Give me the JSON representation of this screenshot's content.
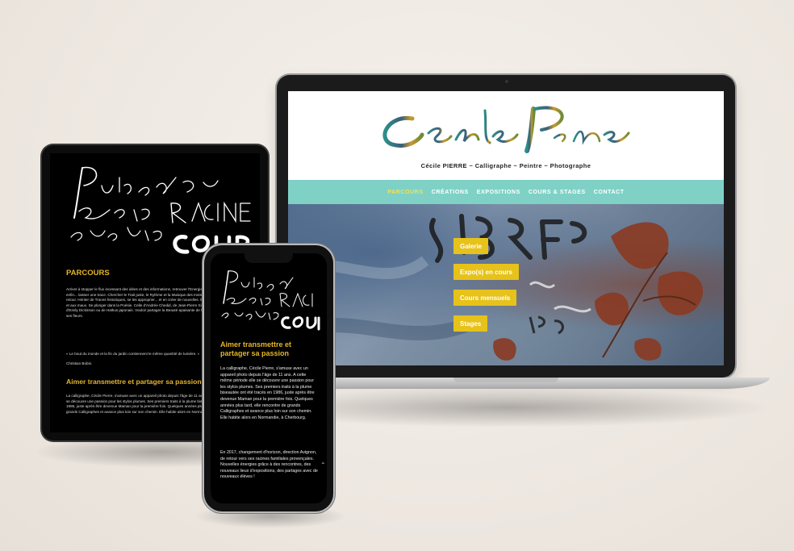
{
  "laptop": {
    "tagline": "Cécile PIERRE ~ Calligraphe ~ Peintre ~ Photographe",
    "nav": [
      "PARCOURS",
      "CRÉATIONS",
      "EXPOSITIONS",
      "COURS & STAGES",
      "CONTACT"
    ],
    "hero_buttons": [
      "Galerie",
      "Expo(s) en cours",
      "Cours mensuels",
      "Stages"
    ]
  },
  "tablet": {
    "section1_heading": "PARCOURS",
    "para1": "Arriver à stopper le flux incessant des idées et des informations, retrouver l'Energie, la libérer grâce au Souffle et enfin... laisser une trace. Chercher le Trait juste, le Rythme et la Musique des mots, le Silence qui les révèlent en retour. Hériter de Traces historiques, se les approprier... et en créer de nouvelles. Être sensible (trop ?) aux Mots et aux maux. Se plonger dans la Poésie. Celle d'Andrée Chedid, de Jean-Pierre Siméon, François Cheng, d'Emily Dickinson ou de Haïkus japonais. Vouloir partager la Beauté apaisante de la Nature qui nous entoure, de ses fleurs.",
    "quote": "« Le bout du monde et la fin du jardin contiennent le même quantité de lumière. »",
    "author": "Christian Bobin.",
    "section2_heading": "Aimer transmettre et partager sa passion",
    "para2": "La calligraphe, Cécile Pierre, s'amuse avec un appareil photo depuis l'âge de 11 ans. A cette même période elle se découvre une passion pour les stylos plumes. Ses premiers traits à la plume biseautée ont été tracés en 1986, juste après être devenue Maman pour la première fois. Quelques années plus tard, elle rencontre de grands Calligraphes et avance plus loin sur son chemin. Elle habite alors en Normandie, à Cherbourg."
  },
  "phone": {
    "heading": "Aimer transmettre et partager sa passion",
    "para1": "La calligraphe, Cécile Pierre, s'amuse avec un appareil photo depuis l'âge de 11 ans. A cette même période elle se découvre une passion pour les stylos plumes. Ses premiers traits à la plume biseautée ont été tracés en 1986, juste après être devenue Maman pour la première fois. Quelques années plus tard, elle rencontre de grands Calligraphes et avance plus loin sur son chemin. Elle habite alors en Normandie, à Cherbourg.",
    "para2": "En 2017, changement d'horizon, direction Avignon, de retour vers ses racines familiales provençales. Nouvelles énergies grâce à des rencontres, des nouveaux lieux d'expositions, des partages avec de nouveaux élèves !",
    "chevron_icon": "chevron-up-icon"
  },
  "colors": {
    "accent_yellow": "#e6c21a",
    "nav_teal": "#7fd1c6",
    "heading_gold": "#e5b52a"
  }
}
